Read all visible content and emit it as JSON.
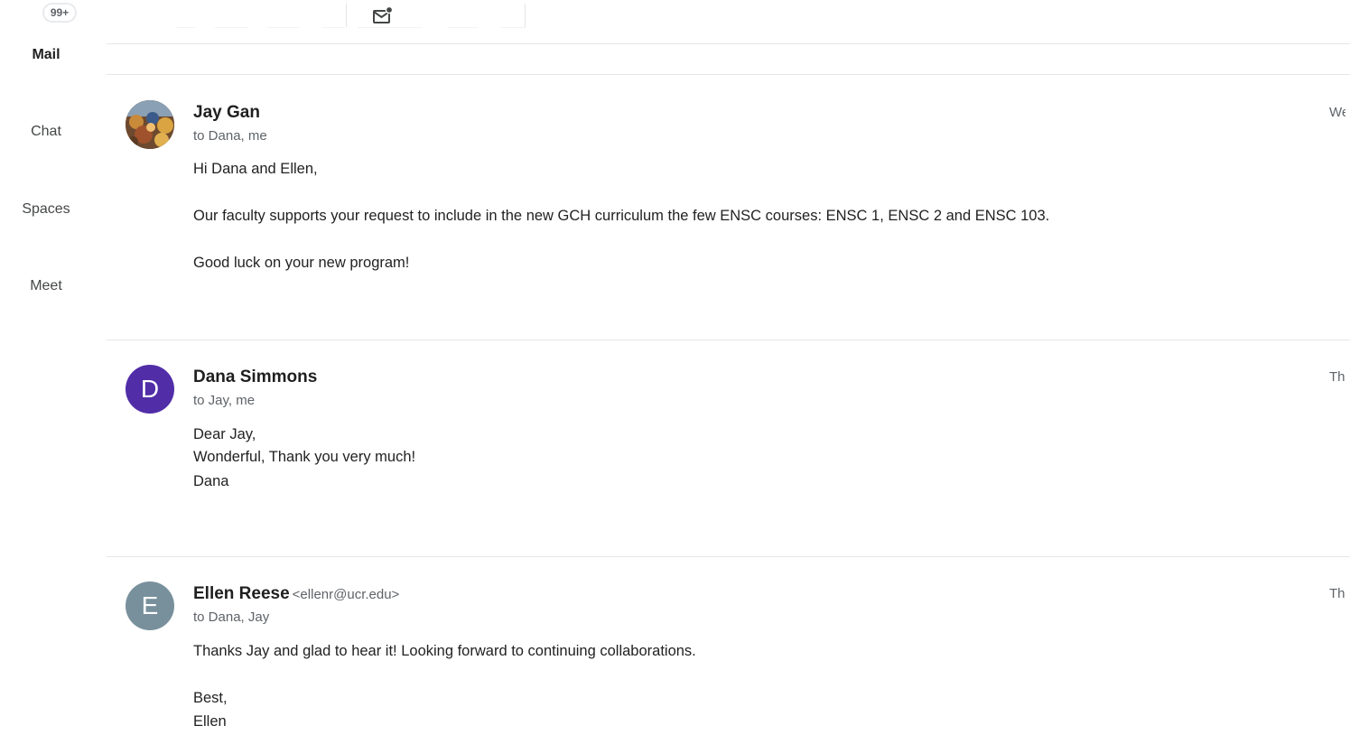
{
  "rail": {
    "badge": "99+",
    "items": [
      {
        "label": "Mail",
        "active": true
      },
      {
        "label": "Chat",
        "active": false
      },
      {
        "label": "Spaces",
        "active": false
      },
      {
        "label": "Meet",
        "active": false
      }
    ]
  },
  "toolbar": {
    "mark_unread_icon": "mail-unread-icon"
  },
  "messages": [
    {
      "sender": "Jay Gan",
      "email": "",
      "recipients": "to Dana, me",
      "date": "We",
      "avatar": {
        "type": "photo"
      },
      "body": [
        "Hi Dana and Ellen,",
        "Our faculty supports your request to include in the new GCH curriculum the few ENSC courses: ENSC 1, ENSC 2 and ENSC 103.",
        "Good luck on your new program!"
      ]
    },
    {
      "sender": "Dana Simmons",
      "email": "",
      "recipients": "to Jay, me",
      "date": "Th",
      "avatar": {
        "type": "letter",
        "letter": "D",
        "color": "#512da8"
      },
      "body": [
        "Dear Jay,",
        "Wonderful, Thank you very much!",
        "Dana"
      ]
    },
    {
      "sender": "Ellen Reese",
      "email": "<ellenr@ucr.edu>",
      "recipients": "to Dana, Jay",
      "date": "Th",
      "avatar": {
        "type": "letter",
        "letter": "E",
        "color": "#78909c"
      },
      "body": [
        "Thanks Jay and glad to hear it! Looking forward to continuing collaborations.",
        "Best,",
        "Ellen"
      ]
    }
  ]
}
